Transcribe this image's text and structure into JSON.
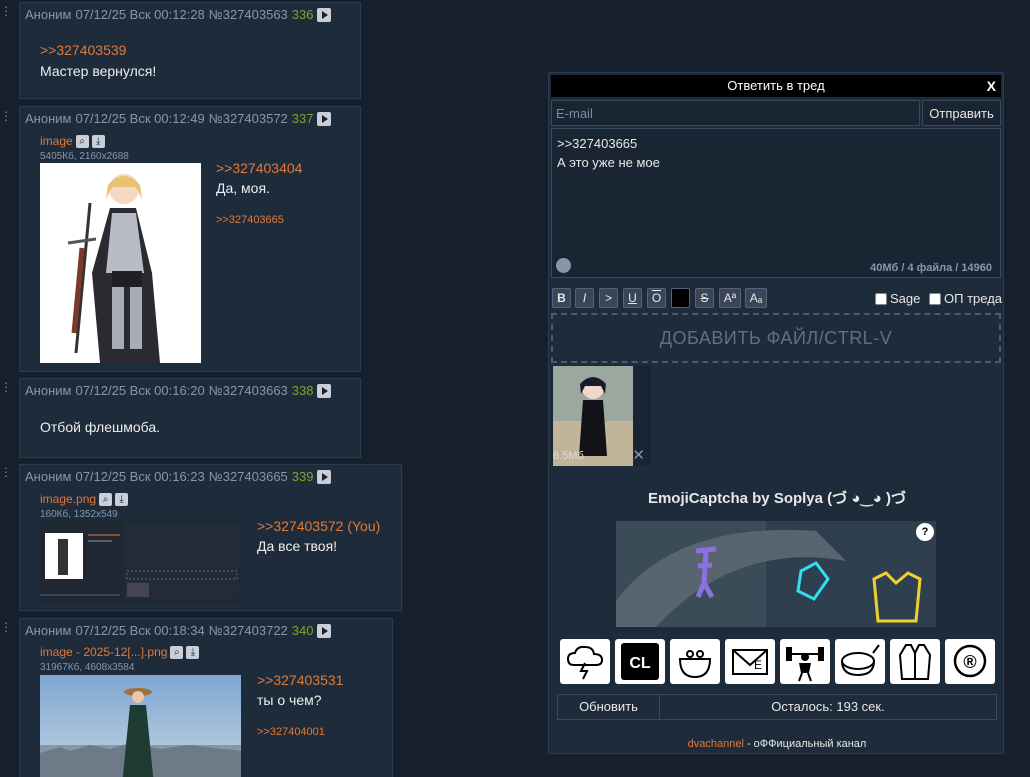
{
  "posts": [
    {
      "author": "Аноним",
      "date": "07/12/25 Вск 00:12:28",
      "id": "№327403563",
      "index": "336",
      "ref": ">>327403539",
      "text": "Мастер вернулся!"
    },
    {
      "author": "Аноним",
      "date": "07/12/25 Вск 00:12:49",
      "id": "№327403572",
      "index": "337",
      "file_name": "image",
      "file_info": "5405Кб, 2160x2688",
      "ref": ">>327403404",
      "text": "Да, моя.",
      "reply": ">>327403665"
    },
    {
      "author": "Аноним",
      "date": "07/12/25 Вск 00:16:20",
      "id": "№327403663",
      "index": "338",
      "text": "Отбой флешмоба."
    },
    {
      "author": "Аноним",
      "date": "07/12/25 Вск 00:16:23",
      "id": "№327403665",
      "index": "339",
      "file_name": "image.png",
      "file_info": "160Кб, 1352x549",
      "ref": ">>327403572 (You)",
      "text": "Да все твоя!"
    },
    {
      "author": "Аноним",
      "date": "07/12/25 Вск 00:18:34",
      "id": "№327403722",
      "index": "340",
      "file_name": "image - 2025-12[...].png",
      "file_info": "31967Кб, 4608x3584",
      "ref": ">>327403531",
      "text": "ты о чем?",
      "reply": ">>327404001"
    }
  ],
  "form": {
    "title": "Ответить в тред",
    "close": "X",
    "email_placeholder": "E-mail",
    "send_label": "Отправить",
    "message": ">>327403665\nА это уже не мое",
    "limits": "40Мб / 4 файла / 14960",
    "fmt": {
      "b": "B",
      "i": "I",
      "quote": ">",
      "u": "U",
      "o": "O",
      "s": "S",
      "sup": "Aª",
      "sub": "Aₐ"
    },
    "sage_label": "Sage",
    "op_label": "ОП треда",
    "drop_label": "ДОБАВИТЬ ФАЙЛ/CTRL-V",
    "attachment_size": "6.5Мб",
    "attachment_close": "✕",
    "captcha_title": "EmojiCaptcha by Soplya (づ ◕‿◕ )づ",
    "captcha_help": "?",
    "emoji_choices": [
      "cloud-lightning",
      "CL",
      "purse",
      "envelope-e",
      "weightlifter",
      "bowl",
      "vest",
      "registered"
    ],
    "emoji_cl_label": "CL",
    "emoji_reg_label": "®",
    "refresh_label": "Обновить",
    "timer_label": "Осталось: 193 сек.",
    "footer_link": "dvachannel",
    "footer_text": " - оФФициальный канал"
  }
}
